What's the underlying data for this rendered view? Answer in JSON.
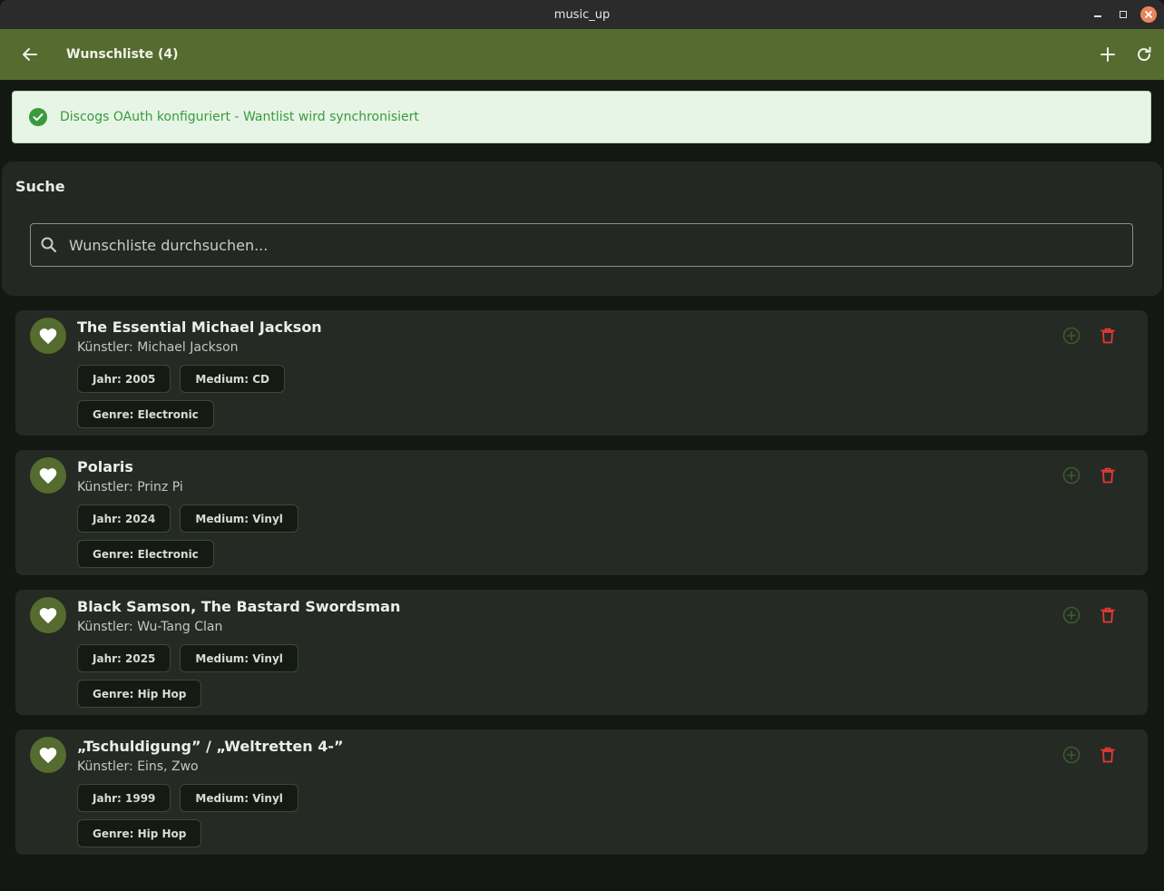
{
  "window": {
    "title": "music_up"
  },
  "appbar": {
    "title": "Wunschliste (4)"
  },
  "banner": {
    "message": "Discogs OAuth konfiguriert - Wantlist wird synchronisiert"
  },
  "search": {
    "label": "Suche",
    "placeholder": "Wunschliste durchsuchen..."
  },
  "colors": {
    "accent": "#556b2f",
    "delete": "#e53935",
    "success": "#3a9a3e"
  },
  "items": [
    {
      "title": "The Essential Michael Jackson",
      "artist": "Künstler: Michael Jackson",
      "year": "Jahr: 2005",
      "medium": "Medium: CD",
      "genre": "Genre: Electronic"
    },
    {
      "title": "Polaris",
      "artist": "Künstler: Prinz Pi",
      "year": "Jahr: 2024",
      "medium": "Medium: Vinyl",
      "genre": "Genre: Electronic"
    },
    {
      "title": "Black Samson, The Bastard Swordsman",
      "artist": "Künstler: Wu-Tang Clan",
      "year": "Jahr: 2025",
      "medium": "Medium: Vinyl",
      "genre": "Genre: Hip Hop"
    },
    {
      "title": "„Tschuldigung” / „Weltretten 4-”",
      "artist": "Künstler: Eins, Zwo",
      "year": "Jahr: 1999",
      "medium": "Medium: Vinyl",
      "genre": "Genre: Hip Hop"
    }
  ]
}
